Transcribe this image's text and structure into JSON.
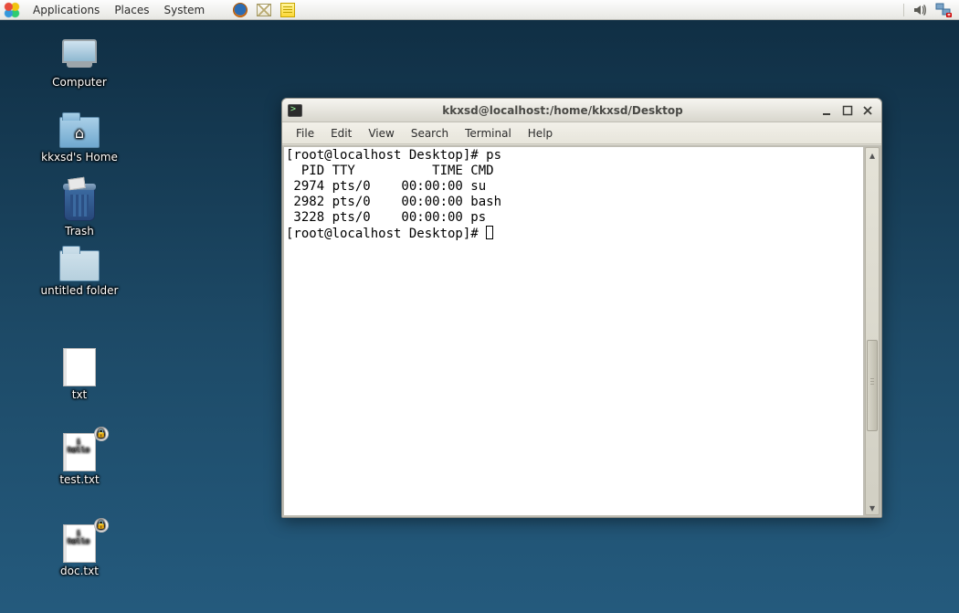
{
  "panel": {
    "menus": {
      "applications": "Applications",
      "places": "Places",
      "system": "System"
    }
  },
  "desktop": {
    "computer": "Computer",
    "home": "kkxsd's Home",
    "trash": "Trash",
    "untitled": "untitled folder",
    "txt": "txt",
    "test": "test.txt",
    "doc": "doc.txt"
  },
  "window": {
    "title": "kkxsd@localhost:/home/kkxsd/Desktop",
    "menus": {
      "file": "File",
      "edit": "Edit",
      "view": "View",
      "search": "Search",
      "terminal": "Terminal",
      "help": "Help"
    }
  },
  "terminal": {
    "lines": [
      "[root@localhost Desktop]# ps",
      "  PID TTY          TIME CMD",
      " 2974 pts/0    00:00:00 su",
      " 2982 pts/0    00:00:00 bash",
      " 3228 pts/0    00:00:00 ps"
    ],
    "prompt": "[root@localhost Desktop]# "
  }
}
